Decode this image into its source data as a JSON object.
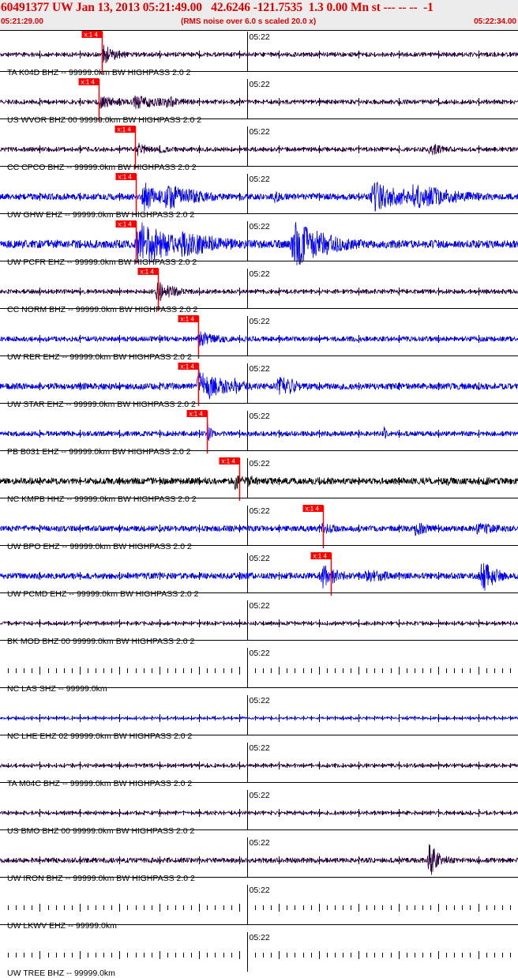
{
  "header": {
    "title": "60491377 UW Jan 13, 2013 05:21:49.00   42.6246 -121.7535  1.3 0.00 Mn st --- -- --  -1",
    "start_time": "05:21:29.00",
    "rms_note": "(RMS noise over 6.0 s scaled 20.0 x)",
    "end_time": "05:22:34.00"
  },
  "chart_data": {
    "type": "line",
    "title": "60491377 UW Jan 13, 2013 05:21:49.00   42.6246 -121.7535  1.3 0.00 Mn st --- -- --  -1",
    "x_start": "05:21:29.00",
    "x_end": "05:22:34.00",
    "x_duration_s": 65,
    "x_tick_label": "05:22",
    "x_tick_label_time_s": 31,
    "pick_label": "x:1 4",
    "colors": {
      "pick": "#ff0000",
      "blue": "#0000ff",
      "dark": "#2a0040",
      "black": "#000000",
      "title": "#e00000"
    },
    "series": [
      {
        "name": "TA K04D BHZ -- 99999.0km BW  HIGHPASS  2.0  2",
        "color": "dark",
        "noise": 2.5,
        "pick_s": 12.8,
        "bursts": [
          [
            13.0,
            2.0,
            15
          ],
          [
            14.5,
            3.0,
            6
          ]
        ]
      },
      {
        "name": "US WVOR BHZ 00 99999.0km BW  HIGHPASS  2.0  2",
        "color": "dark",
        "noise": 2.5,
        "pick_s": 12.4,
        "bursts": [
          [
            12.5,
            4.0,
            9
          ],
          [
            17.0,
            7.0,
            9
          ],
          [
            21.0,
            4.0,
            8
          ]
        ]
      },
      {
        "name": "CC CPCO BHZ -- 99999.0km BW  HIGHPASS  2.0  2",
        "color": "dark",
        "noise": 2.5,
        "pick_s": 16.9,
        "bursts": [
          [
            17.3,
            2.5,
            9
          ],
          [
            20.0,
            3.0,
            5
          ],
          [
            54.0,
            3.0,
            9
          ]
        ]
      },
      {
        "name": "UW GHW EHZ -- 99999.0km BW  HIGHPASS  2.0  2",
        "color": "blue",
        "noise": 4.0,
        "pick_s": 17.0,
        "bursts": [
          [
            18.0,
            3.0,
            20
          ],
          [
            21.0,
            6.0,
            18
          ],
          [
            34.5,
            1.0,
            10
          ],
          [
            47.0,
            6.0,
            20
          ],
          [
            52.0,
            8.0,
            17
          ]
        ]
      },
      {
        "name": "UW PCFR EHZ -- 99999.0km BW  HIGHPASS  2.0  2",
        "color": "blue",
        "noise": 5.0,
        "pick_s": 17.0,
        "bursts": [
          [
            17.5,
            6.0,
            30
          ],
          [
            23.0,
            8.0,
            18
          ],
          [
            37.0,
            6.0,
            30
          ],
          [
            41.0,
            4.0,
            14
          ]
        ]
      },
      {
        "name": "CC NORM BHZ -- 99999.0km BW  HIGHPASS  2.0  2",
        "color": "dark",
        "noise": 2.5,
        "pick_s": 19.8,
        "bursts": [
          [
            19.8,
            3.0,
            15
          ],
          [
            22.0,
            3.0,
            6
          ]
        ]
      },
      {
        "name": "UW RER EHZ -- 99999.0km BW  HIGHPASS  2.0  2",
        "color": "blue",
        "noise": 3.0,
        "pick_s": 24.9,
        "bursts": [
          [
            25.0,
            3.0,
            11
          ],
          [
            27.0,
            4.0,
            6
          ]
        ]
      },
      {
        "name": "UW STAR EHZ -- 99999.0km BW  HIGHPASS  2.0  2",
        "color": "blue",
        "noise": 4.0,
        "pick_s": 24.9,
        "bursts": [
          [
            25.0,
            4.0,
            24
          ],
          [
            29.5,
            3.0,
            11
          ],
          [
            35.0,
            3.0,
            18
          ]
        ]
      },
      {
        "name": "PB B031 EHZ -- 99999.0km BW  HIGHPASS  2.0  2",
        "color": "blue",
        "noise": 3.0,
        "pick_s": 26.0,
        "bursts": [
          [
            26.0,
            0.6,
            22
          ],
          [
            48.2,
            0.5,
            10
          ]
        ]
      },
      {
        "name": "NC KMPB HHZ -- 99999.0km BW  HIGHPASS  2.0  2",
        "color": "black",
        "noise": 4.0,
        "pick_s": 30.0,
        "bursts": [
          [
            29.5,
            1.5,
            12
          ],
          [
            31.0,
            5.0,
            8
          ],
          [
            56.0,
            2.0,
            7
          ],
          [
            61.0,
            3.0,
            6
          ]
        ]
      },
      {
        "name": "UW BPO EHZ -- 99999.0km BW  HIGHPASS  2.0  2",
        "color": "blue",
        "noise": 3.5,
        "pick_s": 40.5,
        "bursts": [
          [
            40.5,
            3.0,
            8
          ],
          [
            52.0,
            4.0,
            10
          ],
          [
            60.0,
            6.0,
            8
          ]
        ]
      },
      {
        "name": "UW PCMD EHZ -- 99999.0km BW  HIGHPASS  2.0  2",
        "color": "blue",
        "noise": 4.0,
        "pick_s": 41.5,
        "bursts": [
          [
            40.5,
            3.0,
            17
          ],
          [
            46.0,
            5.0,
            10
          ],
          [
            60.5,
            2.5,
            22
          ]
        ]
      },
      {
        "name": "BK MOD BHZ 00 99999.0km BW  HIGHPASS  2.0  2",
        "color": "dark",
        "noise": 2.0,
        "pick_s": null,
        "bursts": []
      },
      {
        "name": "NC LAS SHZ -- 99999.0km",
        "color": "dark",
        "noise": 0,
        "pick_s": null,
        "bursts": []
      },
      {
        "name": "NC LHE EHZ 02 99999.0km BW  HIGHPASS  2.0  2",
        "color": "blue",
        "noise": 1.5,
        "pick_s": null,
        "bursts": []
      },
      {
        "name": "TA M04C BHZ -- 99999.0km BW  HIGHPASS  2.0  2",
        "color": "dark",
        "noise": 2.0,
        "pick_s": null,
        "bursts": []
      },
      {
        "name": "US BMO BHZ 00 99999.0km BW  HIGHPASS  2.0  2",
        "color": "dark",
        "noise": 2.0,
        "pick_s": null,
        "bursts": []
      },
      {
        "name": "UW IRON BHZ -- 99999.0km BW  HIGHPASS  2.0  2",
        "color": "dark",
        "noise": 3.0,
        "pick_s": null,
        "bursts": [
          [
            53.8,
            1.5,
            28
          ],
          [
            56.0,
            2.0,
            6
          ]
        ]
      },
      {
        "name": "UW LKWV EHZ -- 99999.0km",
        "color": "dark",
        "noise": 0,
        "pick_s": null,
        "bursts": []
      },
      {
        "name": "UW TREE BHZ -- 99999.0km",
        "color": "dark",
        "noise": 0,
        "pick_s": null,
        "bursts": []
      }
    ]
  }
}
